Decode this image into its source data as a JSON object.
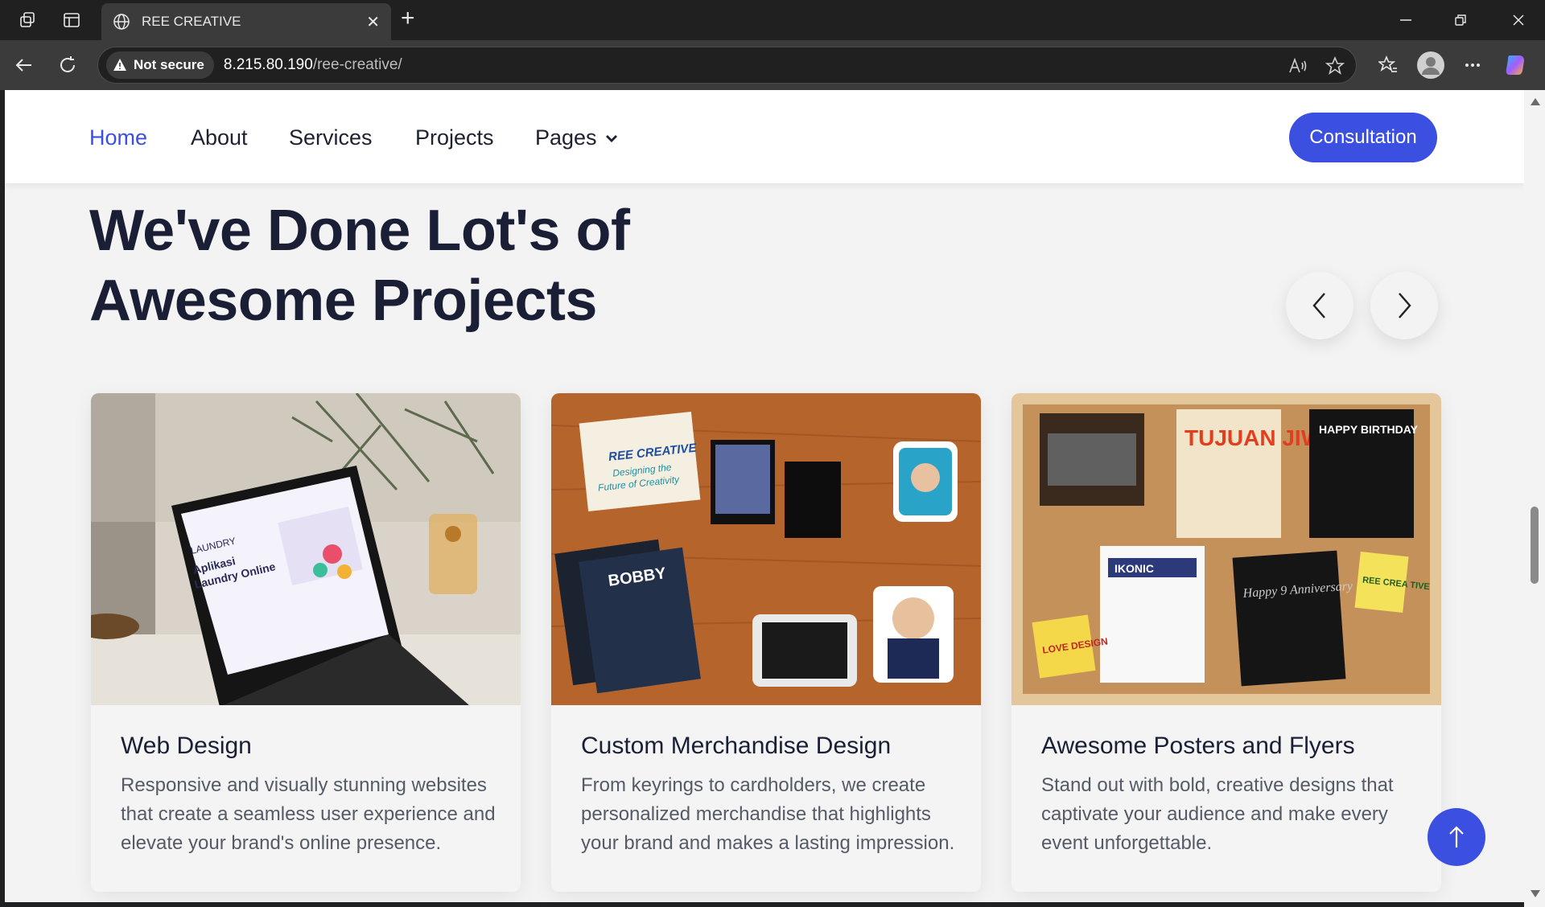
{
  "browser": {
    "tab_title": "REE CREATIVE",
    "security_label": "Not secure",
    "url_host": "8.215.80.190",
    "url_path": "/ree-creative/"
  },
  "nav": {
    "items": [
      {
        "label": "Home",
        "active": true
      },
      {
        "label": "About",
        "active": false
      },
      {
        "label": "Services",
        "active": false
      },
      {
        "label": "Projects",
        "active": false
      },
      {
        "label": "Pages",
        "active": false
      }
    ],
    "cta_label": "Consultation"
  },
  "section": {
    "headline_line1": "We've Done Lot's of",
    "headline_line2": "Awesome Projects"
  },
  "cards": [
    {
      "title": "Web Design",
      "description": "Responsive and visually stunning websites that create a seamless user experience and elevate your brand's online presence.",
      "image_text": [
        "LAUNDRY",
        "Aplikasi",
        "Laundry Online"
      ]
    },
    {
      "title": "Custom Merchandise Design",
      "description": "From keyrings to cardholders, we create personalized merchandise that highlights your brand and makes a lasting impression.",
      "image_text": [
        "REE CREATIVE",
        "Designing the",
        "Future of Creativity",
        "BOBBY"
      ]
    },
    {
      "title": "Awesome Posters and Flyers",
      "description": "Stand out with bold, creative designs that captivate your audience and make every event unforgettable.",
      "image_text": [
        "TUJUAN JIWA",
        "HAPPY BIRTHDAY",
        "IKONIC",
        "Happy 9 Anniversary",
        "LOVE DESIGN",
        "REE CREA TIVE"
      ]
    }
  ],
  "colors": {
    "accent": "#3b50e0",
    "heading": "#1a1f36",
    "body_text": "#555b66",
    "page_bg": "#f3f3f3"
  }
}
